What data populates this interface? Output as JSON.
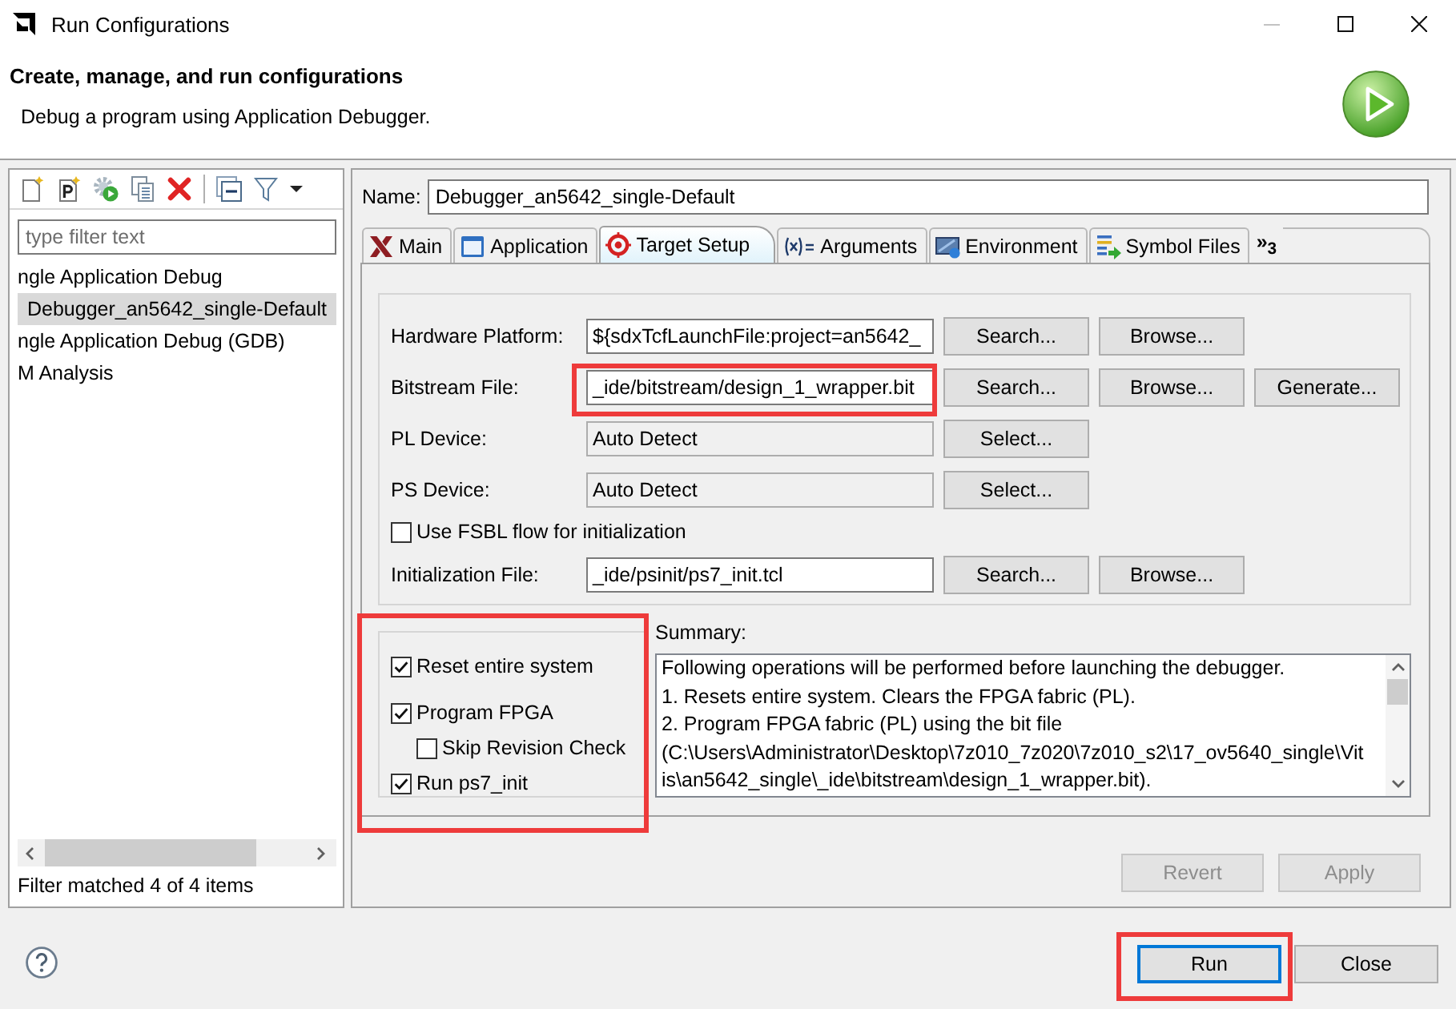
{
  "window": {
    "title": "Run Configurations",
    "controls": [
      {
        "kind": "minimize",
        "disabled": true
      },
      {
        "kind": "maximize",
        "disabled": false
      },
      {
        "kind": "close",
        "disabled": false
      }
    ]
  },
  "header": {
    "title": "Create, manage, and run configurations",
    "subtitle": "Debug a program using Application Debugger."
  },
  "sidebar": {
    "filter": {
      "placeholder": "type filter text"
    },
    "tree": [
      {
        "label": "ngle Application Debug",
        "selected": false,
        "children": [
          {
            "label": "Debugger_an5642_single-Default",
            "selected": true
          }
        ]
      },
      {
        "label": "ngle Application Debug (GDB)",
        "selected": false
      },
      {
        "label": "M Analysis",
        "selected": false
      }
    ],
    "status": "Filter matched 4 of 4 items"
  },
  "editor": {
    "name_label": "Name:",
    "name": "Debugger_an5642_single-Default",
    "tabs": [
      {
        "label": "Main",
        "selected": false
      },
      {
        "label": "Application",
        "selected": false
      },
      {
        "label": "Target Setup",
        "selected": true
      },
      {
        "label": "Arguments",
        "selected": false
      },
      {
        "label": "Environment",
        "selected": false
      },
      {
        "label": "Symbol Files",
        "selected": false
      }
    ],
    "more_tabs": "»$_{3}$",
    "form": {
      "rows": [
        {
          "kind": "field",
          "label": "Hardware Platform:",
          "value": "${sdxTcfLaunchFile:project=an5642_",
          "readonly": false,
          "highlighted": false,
          "buttons": [
            "Search...",
            "Browse..."
          ]
        },
        {
          "kind": "field",
          "label": "Bitstream File:",
          "value": "_ide/bitstream/design_1_wrapper.bit",
          "readonly": false,
          "highlighted": true,
          "buttons": [
            "Search...",
            "Browse...",
            "Generate..."
          ]
        },
        {
          "kind": "field",
          "label": "PL Device:",
          "value": "Auto Detect",
          "readonly": true,
          "highlighted": false,
          "buttons": [
            "Select..."
          ]
        },
        {
          "kind": "field",
          "label": "PS Device:",
          "value": "Auto Detect",
          "readonly": true,
          "highlighted": false,
          "buttons": [
            "Select..."
          ]
        },
        {
          "kind": "checkbox",
          "label": "Use FSBL flow for initialization",
          "checked": false,
          "highlighted": false
        },
        {
          "kind": "field",
          "label": "Initialization File:",
          "value": "_ide/psinit/ps7_init.tcl",
          "readonly": false,
          "highlighted": false,
          "buttons": [
            "Search...",
            "Browse..."
          ]
        }
      ]
    },
    "options": {
      "highlighted": true,
      "items": [
        {
          "label": "Reset entire system",
          "checked": true
        },
        {
          "label": "Program FPGA",
          "checked": true,
          "children": [
            {
              "label": "Skip Revision Check",
              "checked": false
            }
          ]
        },
        {
          "label": "Run ps7_init",
          "checked": true
        }
      ]
    },
    "summary": {
      "label": "Summary:",
      "lines": [
        "Following operations will be performed before launching the debugger.",
        "1. Resets entire system. Clears the FPGA fabric (PL).",
        "2. Program FPGA fabric (PL) using the bit file",
        "(C:\\Users\\Administrator\\Desktop\\7z010_7z020\\7z010_s2\\17_ov5640_single\\Vit",
        "is\\an5642_single\\_ide\\bitstream\\design_1_wrapper.bit)."
      ]
    },
    "buttons": [
      {
        "label": "Revert",
        "disabled": true
      },
      {
        "label": "Apply",
        "disabled": true
      }
    ]
  },
  "footer": {
    "buttons": [
      {
        "label": "Run",
        "focused": true,
        "highlighted": true
      },
      {
        "label": "Close",
        "focused": false,
        "highlighted": false
      }
    ]
  }
}
